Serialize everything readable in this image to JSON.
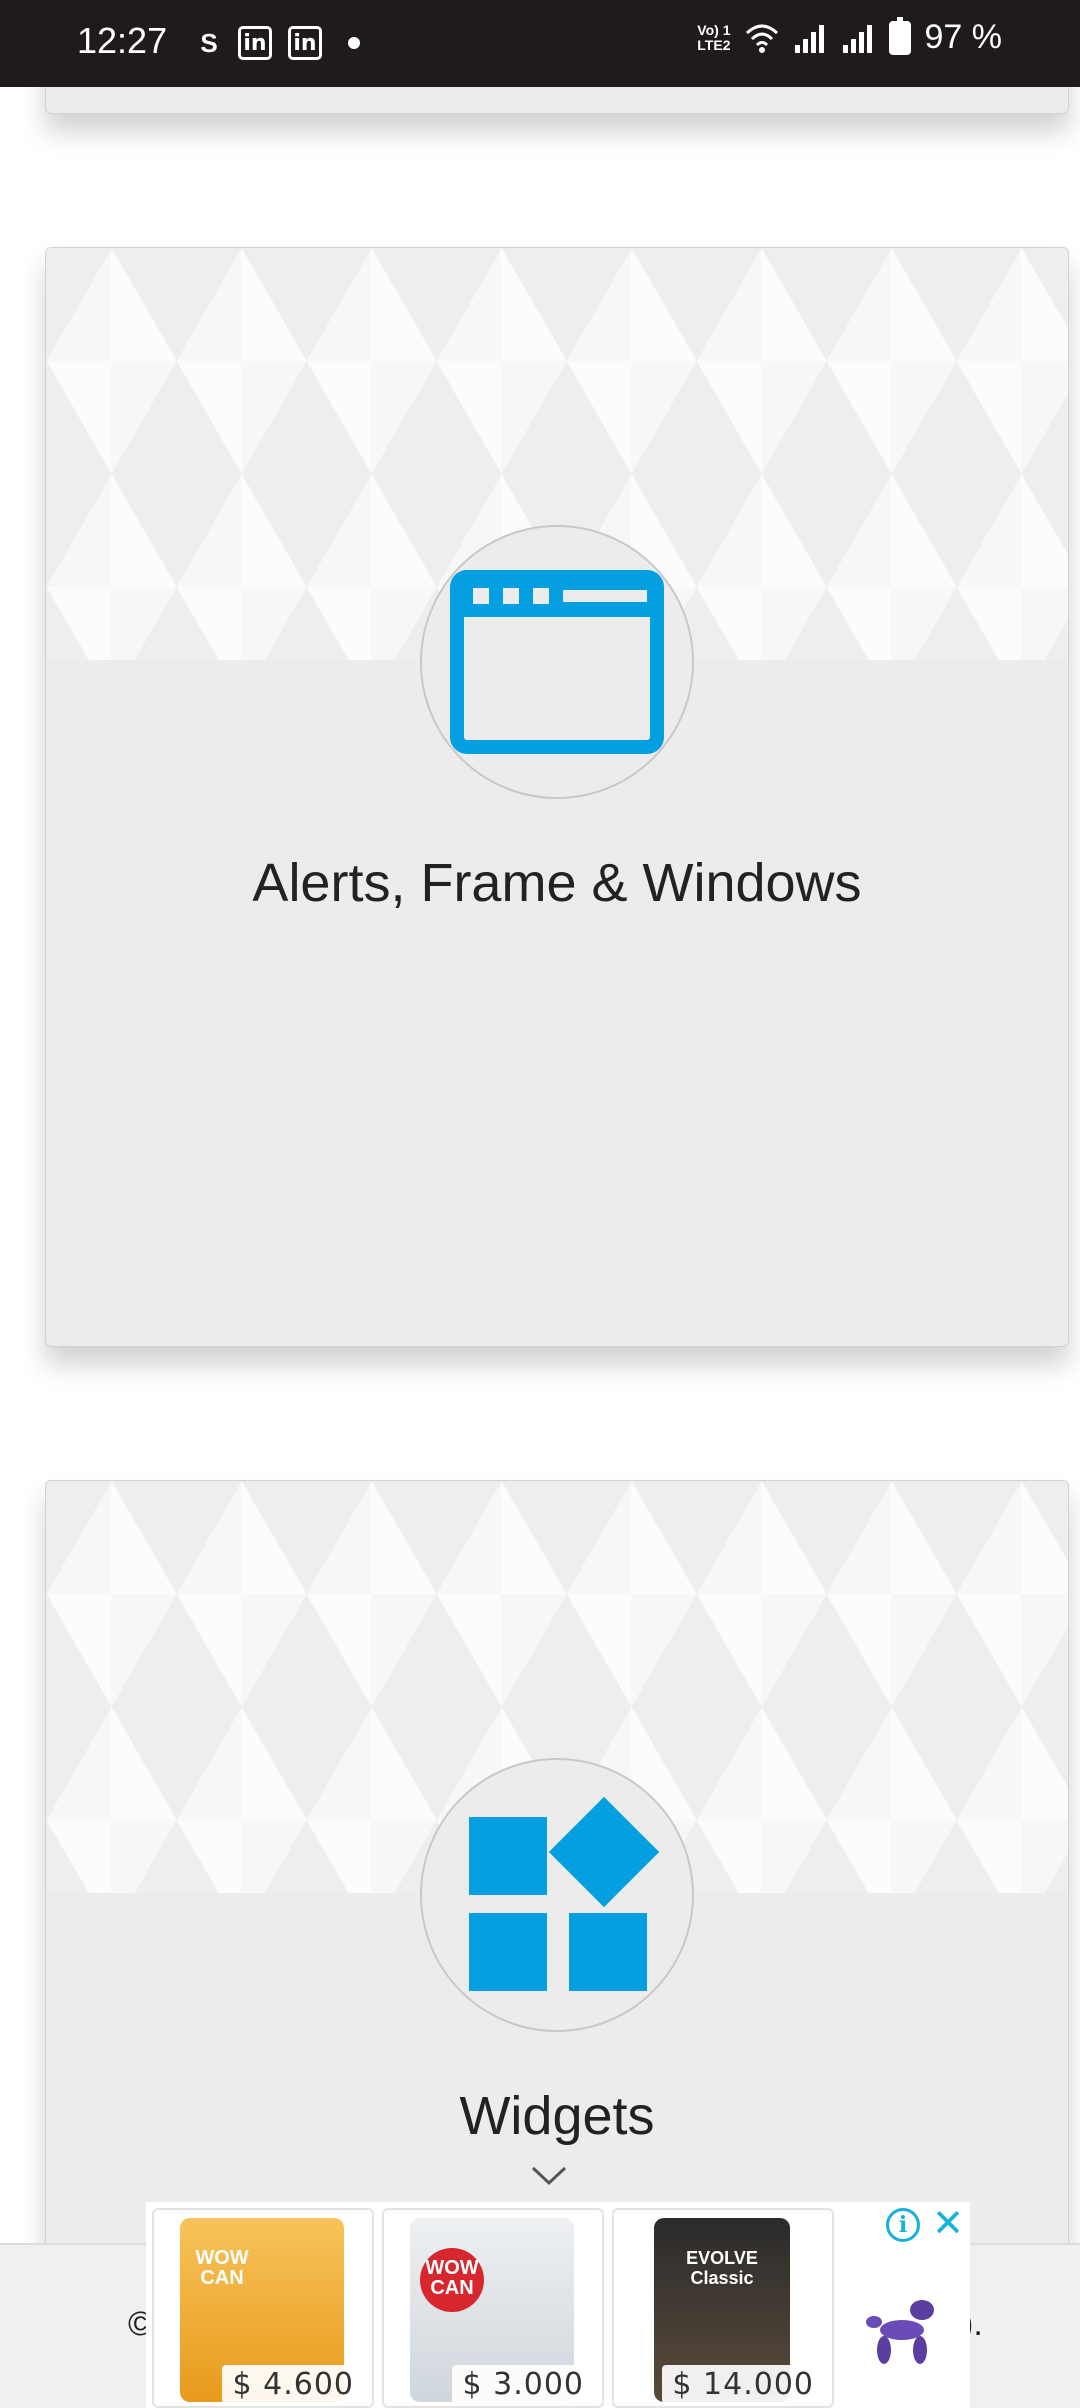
{
  "status_bar": {
    "time": "12:27",
    "network_label": "Vo) 1\nLTE2",
    "battery_percent": "97 %",
    "icons": [
      "s-icon",
      "linkedin-icon",
      "linkedin-icon",
      "notification-dot-icon",
      "wifi-icon",
      "signal-icon",
      "signal-icon",
      "battery-charging-icon"
    ]
  },
  "cards": [
    {
      "title": "Alerts, Frame & Windows",
      "icon": "browser-window-icon"
    },
    {
      "title": "Widgets",
      "icon": "widgets-icon"
    }
  ],
  "footer": {
    "left_text": "©",
    "right_text": ")."
  },
  "ad": {
    "items": [
      {
        "brand": "WOW CAN",
        "price": "$ 4.600"
      },
      {
        "brand": "WOW CAN",
        "price": "$ 3.000"
      },
      {
        "brand": "EVOLVE Classic",
        "price": "$ 14.000"
      }
    ],
    "accent_color": "#14b2dd"
  },
  "colors": {
    "icon_blue": "#039fe0",
    "status_bar": "#1e1b1a",
    "card_bg": "#ececec"
  }
}
